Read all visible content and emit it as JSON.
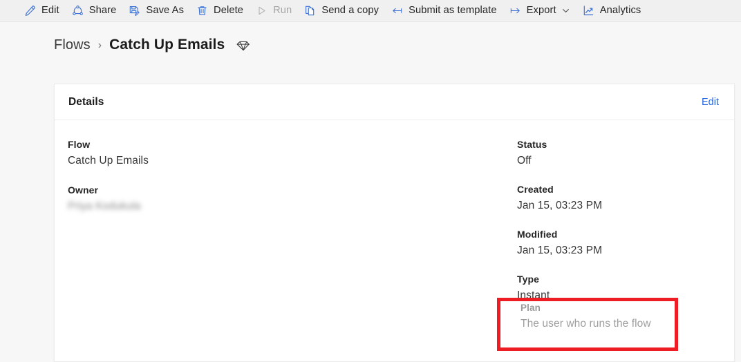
{
  "commandbar": {
    "items": [
      {
        "id": "edit",
        "label": "Edit",
        "icon": "pencil-icon",
        "disabled": false,
        "caret": false
      },
      {
        "id": "share",
        "label": "Share",
        "icon": "share-icon",
        "disabled": false,
        "caret": false
      },
      {
        "id": "save-as",
        "label": "Save As",
        "icon": "save-as-icon",
        "disabled": false,
        "caret": false
      },
      {
        "id": "delete",
        "label": "Delete",
        "icon": "trash-icon",
        "disabled": false,
        "caret": false
      },
      {
        "id": "run",
        "label": "Run",
        "icon": "play-icon",
        "disabled": true,
        "caret": false
      },
      {
        "id": "send-a-copy",
        "label": "Send a copy",
        "icon": "copy-icon",
        "disabled": false,
        "caret": false
      },
      {
        "id": "submit-as-template",
        "label": "Submit as template",
        "icon": "arrow-left-bar-icon",
        "disabled": false,
        "caret": false
      },
      {
        "id": "export",
        "label": "Export",
        "icon": "arrow-right-bar-icon",
        "disabled": false,
        "caret": true
      },
      {
        "id": "analytics",
        "label": "Analytics",
        "icon": "line-chart-icon",
        "disabled": false,
        "caret": false
      }
    ]
  },
  "breadcrumb": {
    "root_label": "Flows",
    "separator": "›",
    "current_label": "Catch Up Emails",
    "premium_icon": "diamond-icon"
  },
  "details_card": {
    "title": "Details",
    "edit_label": "Edit",
    "left_fields": [
      {
        "label": "Flow",
        "value": "Catch Up Emails",
        "blurred": false,
        "muted": false
      },
      {
        "label": "Owner",
        "value": "Priya Kodukula",
        "blurred": true,
        "muted": false
      }
    ],
    "right_fields": [
      {
        "label": "Status",
        "value": "Off",
        "blurred": false,
        "muted": false
      },
      {
        "label": "Created",
        "value": "Jan 15, 03:23 PM",
        "blurred": false,
        "muted": false
      },
      {
        "label": "Modified",
        "value": "Jan 15, 03:23 PM",
        "blurred": false,
        "muted": false
      },
      {
        "label": "Type",
        "value": "Instant",
        "blurred": false,
        "muted": false
      }
    ],
    "plan_field": {
      "label": "Plan",
      "value": "The user who runs the flow",
      "muted": true
    }
  },
  "annotation": {
    "name": "plan-highlight-box",
    "color": "#ee1c23"
  },
  "colors": {
    "accent_blue": "#2266e3",
    "icon_blue": "#3b6fd4",
    "page_background": "#f7f7f7",
    "commandbar_background": "#f0f0f0",
    "card_background": "#ffffff",
    "disabled_text": "#a6a6a6",
    "annotation_red": "#ee1c23"
  }
}
